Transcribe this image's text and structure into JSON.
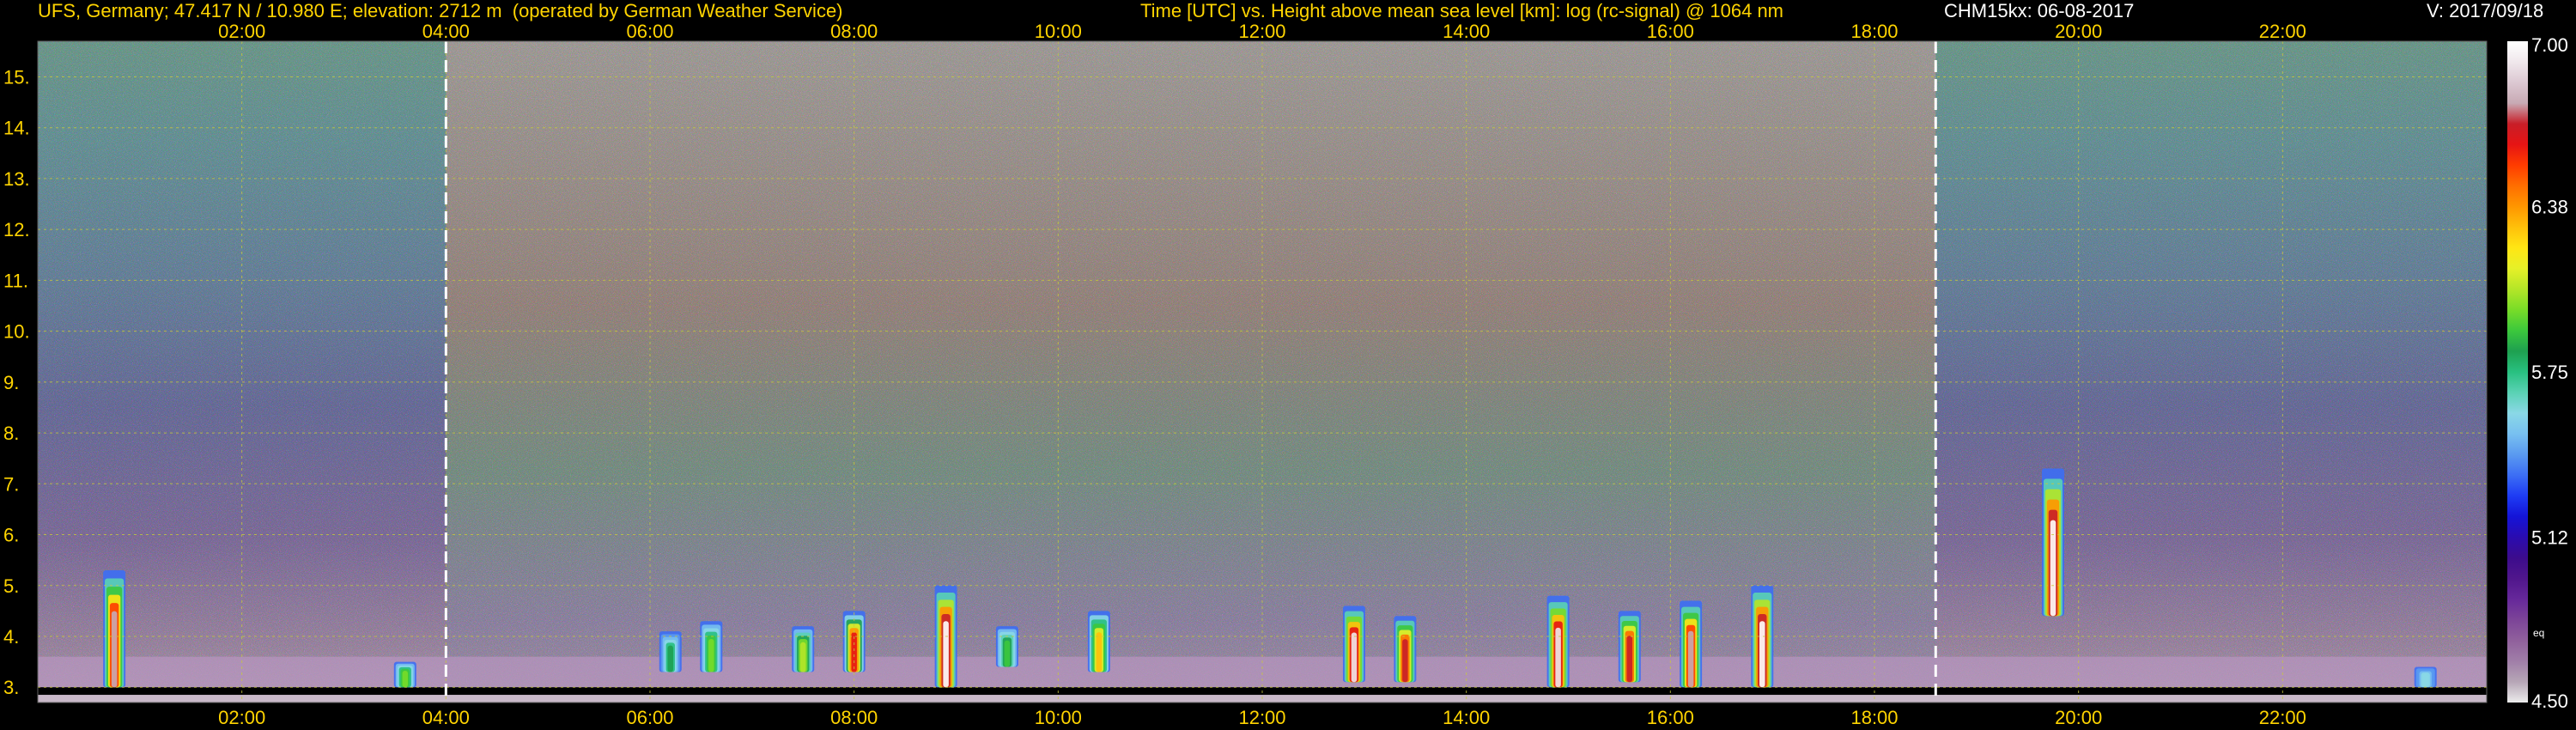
{
  "header": {
    "station": "UFS, Germany; 47.417 N / 10.980 E; elevation: 2712 m  (operated by German Weather Service)",
    "plot_title": "Time [UTC] vs. Height above mean sea level [km]: log (rc-signal) @ 1064 nm",
    "instrument_date": "CHM15kx: 06-08-2017",
    "version": "V: 2017/09/18"
  },
  "colors": {
    "header_text": "#ffd400",
    "grid": "#c8c83c",
    "marker_line": "#ffffff",
    "background": "#000000"
  },
  "chart_data": {
    "type": "heatmap",
    "title": "Time [UTC] vs. Height above mean sea level [km]: log (rc-signal) @ 1064 nm",
    "xlabel": "Time [UTC]",
    "ylabel": "Height above mean sea level [km]",
    "x_ticks": [
      "02:00",
      "04:00",
      "06:00",
      "08:00",
      "10:00",
      "12:00",
      "14:00",
      "16:00",
      "18:00",
      "20:00",
      "22:00"
    ],
    "x_tick_hours": [
      2,
      4,
      6,
      8,
      10,
      12,
      14,
      16,
      18,
      20,
      22
    ],
    "xlim_hours": [
      0,
      24
    ],
    "y_ticks": [
      "3.",
      "4.",
      "5.",
      "6.",
      "7.",
      "8.",
      "9.",
      "10.",
      "11.",
      "12.",
      "13.",
      "14.",
      "15."
    ],
    "y_tick_values": [
      3,
      4,
      5,
      6,
      7,
      8,
      9,
      10,
      11,
      12,
      13,
      14,
      15
    ],
    "ylim_km": [
      2.7,
      15.7
    ],
    "grid": true,
    "sunrise_sunset_markers_hours": [
      4.0,
      18.6
    ],
    "colorbar": {
      "range": [
        4.5,
        7.0
      ],
      "tick_labels": [
        "7.00",
        "6.38",
        "5.75",
        "5.12",
        "4.50"
      ],
      "tick_values": [
        7.0,
        6.375,
        5.75,
        5.125,
        4.5
      ],
      "extra_label": "eq",
      "colors": [
        "#ececec",
        "#b6a6b6",
        "#a07ea8",
        "#90609c",
        "#7c4498",
        "#66289a",
        "#50168c",
        "#3c0c8c",
        "#2a0cb0",
        "#1414d8",
        "#1e3cf4",
        "#3c6ef4",
        "#5a9af0",
        "#78c0f0",
        "#8ad8e6",
        "#5ad2b4",
        "#28c080",
        "#1ea050",
        "#3cc83c",
        "#78dc28",
        "#b4e628",
        "#e6f028",
        "#ffe614",
        "#ffc00a",
        "#ff9600",
        "#ff6e00",
        "#ff3c00",
        "#e61414",
        "#c81e28",
        "#c8aab4",
        "#dcc8d2",
        "#f0e8ec",
        "#ffffff"
      ]
    },
    "cloud_events": [
      {
        "time_hours": 0.75,
        "base_km": 3.0,
        "top_km": 5.3,
        "peak_value": 6.8
      },
      {
        "time_hours": 3.6,
        "base_km": 3.0,
        "top_km": 3.5,
        "peak_value": 6.0
      },
      {
        "time_hours": 6.2,
        "base_km": 3.3,
        "top_km": 4.1,
        "peak_value": 5.8
      },
      {
        "time_hours": 6.6,
        "base_km": 3.3,
        "top_km": 4.3,
        "peak_value": 6.0
      },
      {
        "time_hours": 7.5,
        "base_km": 3.3,
        "top_km": 4.2,
        "peak_value": 6.1
      },
      {
        "time_hours": 8.0,
        "base_km": 3.3,
        "top_km": 4.5,
        "peak_value": 6.6
      },
      {
        "time_hours": 8.9,
        "base_km": 3.0,
        "top_km": 5.0,
        "peak_value": 7.0
      },
      {
        "time_hours": 9.5,
        "base_km": 3.4,
        "top_km": 4.2,
        "peak_value": 5.9
      },
      {
        "time_hours": 10.4,
        "base_km": 3.3,
        "top_km": 4.5,
        "peak_value": 6.3
      },
      {
        "time_hours": 12.9,
        "base_km": 3.1,
        "top_km": 4.6,
        "peak_value": 6.9
      },
      {
        "time_hours": 13.4,
        "base_km": 3.1,
        "top_km": 4.4,
        "peak_value": 6.7
      },
      {
        "time_hours": 14.9,
        "base_km": 3.0,
        "top_km": 4.8,
        "peak_value": 6.9
      },
      {
        "time_hours": 15.6,
        "base_km": 3.1,
        "top_km": 4.5,
        "peak_value": 6.7
      },
      {
        "time_hours": 16.2,
        "base_km": 3.0,
        "top_km": 4.7,
        "peak_value": 6.8
      },
      {
        "time_hours": 16.9,
        "base_km": 3.0,
        "top_km": 5.0,
        "peak_value": 7.0
      },
      {
        "time_hours": 19.75,
        "base_km": 4.4,
        "top_km": 7.3,
        "peak_value": 7.0
      },
      {
        "time_hours": 23.4,
        "base_km": 3.0,
        "top_km": 3.4,
        "peak_value": 5.6
      }
    ]
  }
}
